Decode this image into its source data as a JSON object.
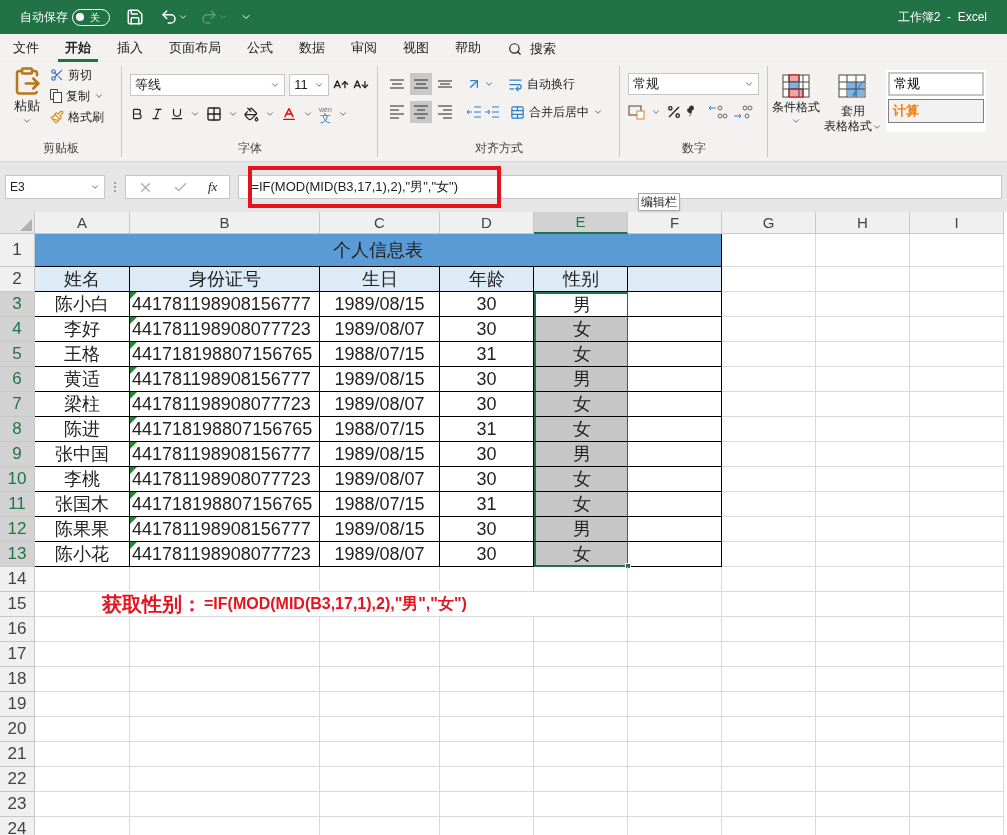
{
  "title_bar": {
    "autosave_label": "自动保存",
    "autosave": {
      "on": false,
      "label": "关"
    },
    "title": "工作簿2  -  Excel"
  },
  "menu_tabs": [
    {
      "label": "文件",
      "selected": false
    },
    {
      "label": "开始",
      "selected": true
    },
    {
      "label": "插入",
      "selected": false
    },
    {
      "label": "页面布局",
      "selected": false
    },
    {
      "label": "公式",
      "selected": false
    },
    {
      "label": "数据",
      "selected": false
    },
    {
      "label": "审阅",
      "selected": false
    },
    {
      "label": "视图",
      "selected": false
    },
    {
      "label": "帮助",
      "selected": false
    }
  ],
  "search": "搜索",
  "clipboard": {
    "paste": "粘贴",
    "cut": "剪切",
    "copy": "复制",
    "format_painter": "格式刷",
    "title": "剪贴板"
  },
  "font": {
    "font_name": "等线",
    "font_size": "11",
    "phonetic_top": "wén",
    "phonetic_bottom": "文",
    "title": "字体"
  },
  "alignment": {
    "buttons": [
      {
        "kind": "top",
        "selected": false
      },
      {
        "kind": "middle",
        "selected": true
      },
      {
        "kind": "bottom",
        "selected": false
      },
      {
        "kind": "left",
        "selected": false
      },
      {
        "kind": "center",
        "selected": true
      },
      {
        "kind": "right",
        "selected": false
      }
    ],
    "wrap": "自动换行",
    "merge": "合并后居中",
    "title": "对齐方式"
  },
  "number": {
    "format": "常规",
    "title": "数字"
  },
  "styles": {
    "conditional": "条件格式",
    "table_format": [
      "套用",
      "表格格式"
    ],
    "cell_styles": [
      {
        "label": "常规",
        "kind": "normal"
      },
      {
        "label": "计算",
        "kind": "calc"
      }
    ]
  },
  "formula_bar": {
    "name_box": "E3",
    "function_label": "fx",
    "formula": "=IF(MOD(MID(B3,17,1),2),\"男\",\"女\")",
    "tooltip": "编辑栏"
  },
  "sheet": {
    "columns": [
      {
        "label": "A",
        "selected": false
      },
      {
        "label": "B",
        "selected": false
      },
      {
        "label": "C",
        "selected": false
      },
      {
        "label": "D",
        "selected": false
      },
      {
        "label": "E",
        "selected": true
      },
      {
        "label": "F",
        "selected": false
      },
      {
        "label": "G",
        "selected": false
      },
      {
        "label": "H",
        "selected": false
      },
      {
        "label": "I",
        "selected": false
      }
    ],
    "title_row": "1",
    "title": "个人信息表",
    "header_row": "2",
    "headers": [
      "姓名",
      "身份证号",
      "生日",
      "年龄",
      "性别"
    ],
    "rows": [
      {
        "number": "3",
        "cells": [
          "陈小白",
          "441781198908156777",
          "1989/08/15",
          "30",
          "男"
        ],
        "selected": true,
        "active": true,
        "flagged": true
      },
      {
        "number": "4",
        "cells": [
          "李好",
          "441781198908077723",
          "1989/08/07",
          "30",
          "女"
        ],
        "selected": true,
        "active": false,
        "flagged": true
      },
      {
        "number": "5",
        "cells": [
          "王格",
          "441718198807156765",
          "1988/07/15",
          "31",
          "女"
        ],
        "selected": true,
        "active": false,
        "flagged": true
      },
      {
        "number": "6",
        "cells": [
          "黄适",
          "441781198908156777",
          "1989/08/15",
          "30",
          "男"
        ],
        "selected": true,
        "active": false,
        "flagged": true
      },
      {
        "number": "7",
        "cells": [
          "梁柱",
          "441781198908077723",
          "1989/08/07",
          "30",
          "女"
        ],
        "selected": true,
        "active": false,
        "flagged": true
      },
      {
        "number": "8",
        "cells": [
          "陈进",
          "441718198807156765",
          "1988/07/15",
          "31",
          "女"
        ],
        "selected": true,
        "active": false,
        "flagged": true
      },
      {
        "number": "9",
        "cells": [
          "张中国",
          "441781198908156777",
          "1989/08/15",
          "30",
          "男"
        ],
        "selected": true,
        "active": false,
        "flagged": true
      },
      {
        "number": "10",
        "cells": [
          "李桃",
          "441781198908077723",
          "1989/08/07",
          "30",
          "女"
        ],
        "selected": true,
        "active": false,
        "flagged": true
      },
      {
        "number": "11",
        "cells": [
          "张国木",
          "441718198807156765",
          "1988/07/15",
          "31",
          "女"
        ],
        "selected": true,
        "active": false,
        "flagged": true
      },
      {
        "number": "12",
        "cells": [
          "陈果果",
          "441781198908156777",
          "1989/08/15",
          "30",
          "男"
        ],
        "selected": true,
        "active": false,
        "flagged": true
      },
      {
        "number": "13",
        "cells": [
          "陈小花",
          "441781198908077723",
          "1989/08/07",
          "30",
          "女"
        ],
        "selected": true,
        "active": false,
        "flagged": true
      }
    ],
    "empty_rows": [
      {
        "number": "14"
      },
      {
        "number": "15",
        "note": {
          "label": "获取性别：",
          "formula": "=IF(MOD(MID(B3,17,1),2),\"男\",\"女\")"
        }
      },
      {
        "number": "16"
      },
      {
        "number": "17"
      },
      {
        "number": "18"
      },
      {
        "number": "19"
      },
      {
        "number": "20"
      },
      {
        "number": "21"
      },
      {
        "number": "22"
      },
      {
        "number": "23"
      },
      {
        "number": "24"
      }
    ]
  }
}
